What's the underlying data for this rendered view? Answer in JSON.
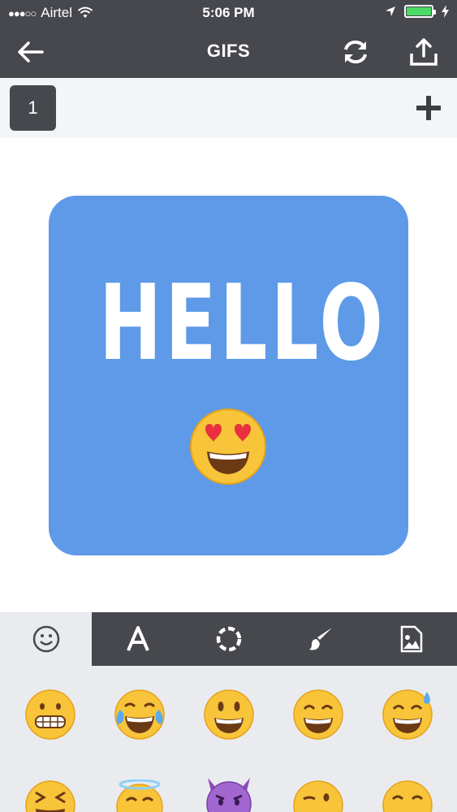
{
  "status_bar": {
    "carrier": "Airtel",
    "signal_dots": "●●●○○",
    "time": "5:06 PM"
  },
  "nav": {
    "title": "GIFS",
    "icons": [
      "back-arrow-icon",
      "refresh-icon",
      "share-upload-icon"
    ]
  },
  "frame_bar": {
    "frame_number": "1",
    "icons": [
      "add-frame-plus-icon"
    ]
  },
  "canvas": {
    "text": "HELLO",
    "background_color": "#5e9ae8",
    "emoji": "heart-eyes-emoji"
  },
  "tools": {
    "selected": "emoji",
    "tabs": [
      {
        "name": "emoji",
        "icon": "smiley-icon"
      },
      {
        "name": "text",
        "label": "A",
        "icon": "text-icon"
      },
      {
        "name": "shape",
        "icon": "dotted-circle-icon"
      },
      {
        "name": "brush",
        "icon": "brush-icon"
      },
      {
        "name": "image",
        "icon": "image-icon"
      }
    ]
  },
  "emoji_grid": {
    "rows": [
      [
        "grimacing",
        "tears-of-joy",
        "smiley",
        "grinning-smile",
        "sweat-smile"
      ],
      [
        "laughing",
        "halo-innocent",
        "smiling-imp",
        "winking",
        "blush"
      ]
    ]
  },
  "colors": {
    "dark_bar": "#46484e",
    "accent_blue": "#5e9ae8",
    "battery_green": "#4cd964"
  }
}
